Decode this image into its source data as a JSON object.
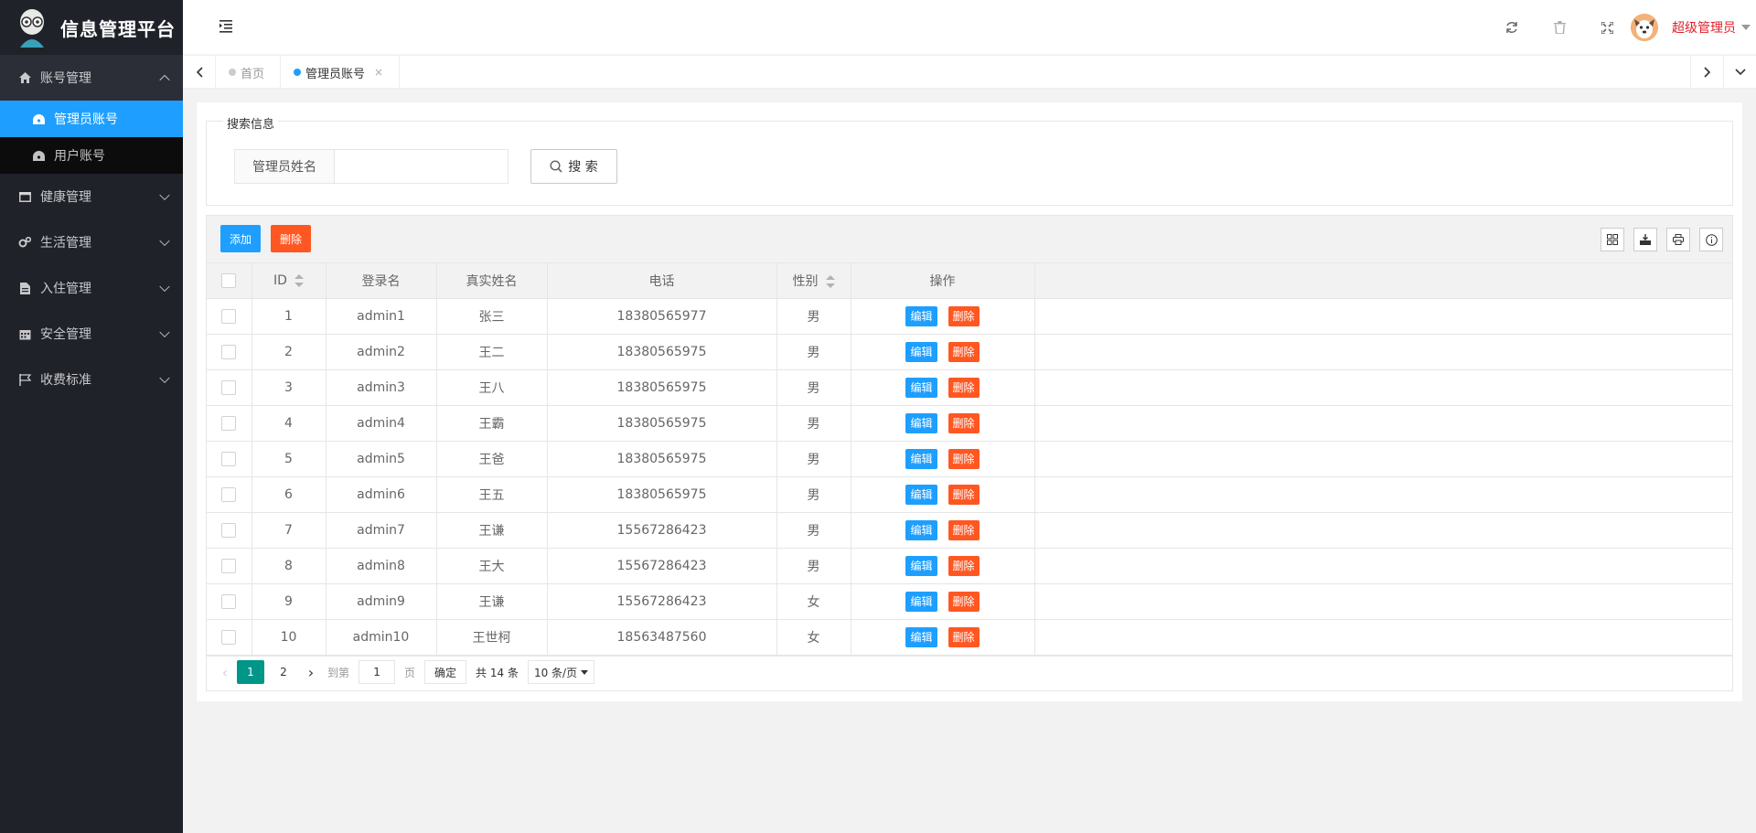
{
  "app": {
    "title": "信息管理平台"
  },
  "sidebar": {
    "items": [
      {
        "label": "账号管理",
        "icon": "home-icon",
        "open": true,
        "children": [
          {
            "label": "管理员账号",
            "icon": "dashboard-icon",
            "active": true
          },
          {
            "label": "用户账号",
            "icon": "dashboard-icon",
            "active": false
          }
        ]
      },
      {
        "label": "健康管理",
        "icon": "window-icon"
      },
      {
        "label": "生活管理",
        "icon": "gears-icon"
      },
      {
        "label": "入住管理",
        "icon": "file-icon"
      },
      {
        "label": "安全管理",
        "icon": "calendar-icon"
      },
      {
        "label": "收费标准",
        "icon": "flag-icon"
      }
    ]
  },
  "header": {
    "icons": [
      "refresh-icon",
      "trash-icon",
      "fullscreen-icon"
    ],
    "user_name": "超级管理员"
  },
  "tabs": [
    {
      "label": "首页",
      "active": false
    },
    {
      "label": "管理员账号",
      "active": true,
      "close": "×"
    }
  ],
  "search": {
    "legend": "搜索信息",
    "field_label": "管理员姓名",
    "field_value": "",
    "button_label": "搜 索"
  },
  "toolbar": {
    "add_label": "添加",
    "delete_label": "删除",
    "icons": [
      "columns-icon",
      "export-icon",
      "print-icon",
      "info-icon"
    ]
  },
  "table": {
    "columns": [
      "ID",
      "登录名",
      "真实姓名",
      "电话",
      "性别",
      "操作"
    ],
    "edit_label": "编辑",
    "delete_label": "删除",
    "rows": [
      {
        "id": "1",
        "login": "admin1",
        "name": "张三",
        "phone": "18380565977",
        "gender": "男"
      },
      {
        "id": "2",
        "login": "admin2",
        "name": "王二",
        "phone": "18380565975",
        "gender": "男"
      },
      {
        "id": "3",
        "login": "admin3",
        "name": "王八",
        "phone": "18380565975",
        "gender": "男"
      },
      {
        "id": "4",
        "login": "admin4",
        "name": "王霸",
        "phone": "18380565975",
        "gender": "男"
      },
      {
        "id": "5",
        "login": "admin5",
        "name": "王爸",
        "phone": "18380565975",
        "gender": "男"
      },
      {
        "id": "6",
        "login": "admin6",
        "name": "王五",
        "phone": "18380565975",
        "gender": "男"
      },
      {
        "id": "7",
        "login": "admin7",
        "name": "王谦",
        "phone": "15567286423",
        "gender": "男"
      },
      {
        "id": "8",
        "login": "admin8",
        "name": "王大",
        "phone": "15567286423",
        "gender": "男"
      },
      {
        "id": "9",
        "login": "admin9",
        "name": "王谦",
        "phone": "15567286423",
        "gender": "女"
      },
      {
        "id": "10",
        "login": "admin10",
        "name": "王世柯",
        "phone": "18563487560",
        "gender": "女"
      }
    ]
  },
  "pagination": {
    "pages": [
      "1",
      "2"
    ],
    "current": "1",
    "goto_label": "到第",
    "goto_value": "1",
    "page_unit": "页",
    "confirm_label": "确定",
    "total_label": "共 14 条",
    "limit_label": "10 条/页"
  }
}
